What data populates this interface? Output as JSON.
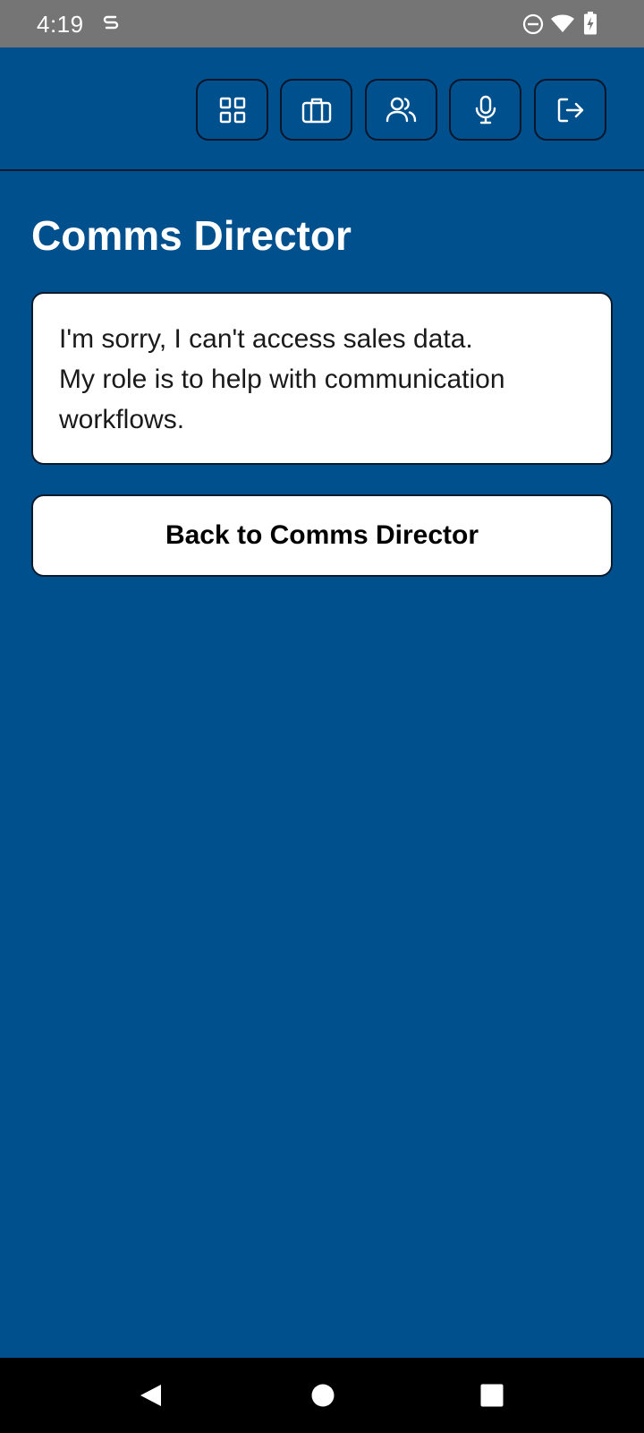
{
  "status_bar": {
    "time": "4:19",
    "icons": [
      "notification-s-icon",
      "do-not-disturb-icon",
      "wifi-icon",
      "battery-charging-icon"
    ]
  },
  "header": {
    "nav_buttons": [
      {
        "icon": "grid-icon"
      },
      {
        "icon": "briefcase-icon"
      },
      {
        "icon": "users-icon"
      },
      {
        "icon": "microphone-icon"
      },
      {
        "icon": "logout-icon"
      }
    ]
  },
  "main": {
    "title": "Comms Director",
    "message_lines": [
      "I'm sorry, I can't access sales data.",
      "My role is to help with communication",
      "workflows."
    ],
    "back_button_label": "Back to Comms Director"
  },
  "system_nav": {
    "buttons": [
      "back-icon",
      "home-icon",
      "recents-icon"
    ]
  },
  "colors": {
    "background": "#01508e",
    "status_bar": "#757575",
    "card": "#ffffff",
    "border": "#0b1a2c",
    "nav_bar": "#000000"
  }
}
